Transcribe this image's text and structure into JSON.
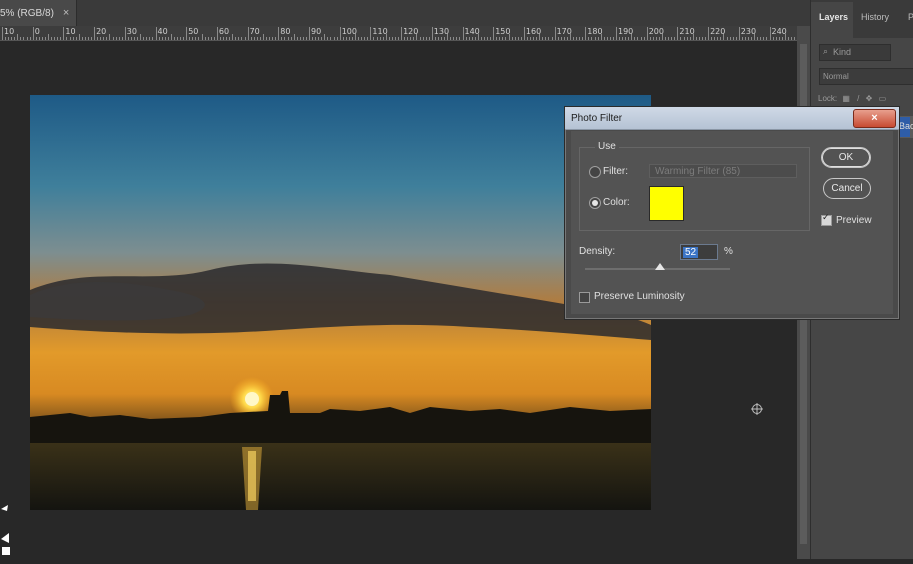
{
  "document_tab": {
    "title": "5% (RGB/8)",
    "close": "×"
  },
  "ruler": {
    "labels": [
      "10",
      "0",
      "10",
      "20",
      "30",
      "40",
      "50",
      "60",
      "70",
      "80",
      "90",
      "100",
      "110",
      "120",
      "130",
      "140",
      "150",
      "160",
      "170",
      "180",
      "190",
      "200",
      "210",
      "220",
      "230",
      "240"
    ]
  },
  "panel": {
    "tabs": [
      "Layers",
      "History",
      "P"
    ],
    "kind_placeholder": "Kind",
    "blend_mode": "Normal",
    "lock_label": "Lock:",
    "layer_name": "Backgrou"
  },
  "dialog": {
    "title": "Photo Filter",
    "close": "×",
    "use_legend": "Use",
    "filter_label": "Filter:",
    "filter_value": "Warming Filter (85)",
    "color_label": "Color:",
    "color_swatch": "#ffff00",
    "density_label": "Density:",
    "density_value": "52",
    "density_unit": "%",
    "density_slider_level": 0.52,
    "preserve_label": "Preserve Luminosity",
    "preserve_checked": false,
    "ok_label": "OK",
    "cancel_label": "Cancel",
    "preview_label": "Preview",
    "preview_checked": true,
    "use_mode": "color"
  },
  "colors": {
    "accent_selection": "#3c75c6",
    "title_bar": "#c5d1df"
  }
}
